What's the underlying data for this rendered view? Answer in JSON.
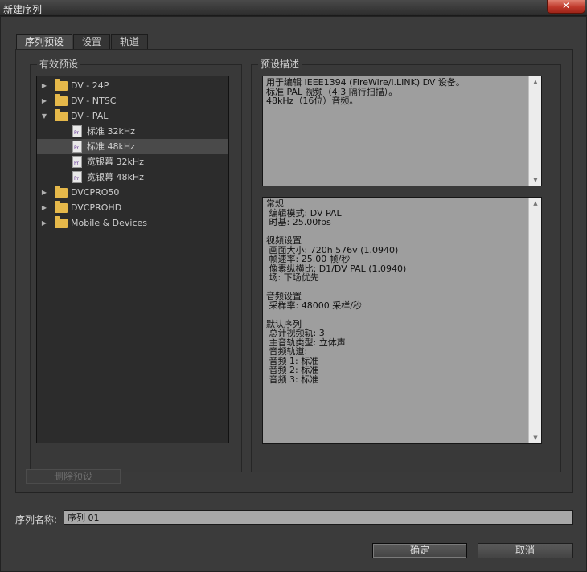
{
  "window": {
    "title": "新建序列",
    "close_glyph": "✕"
  },
  "tabs": [
    {
      "label": "序列预设",
      "active": true
    },
    {
      "label": "设置",
      "active": false
    },
    {
      "label": "轨道",
      "active": false
    }
  ],
  "presets": {
    "group_label": "有效预设",
    "tree": [
      {
        "type": "folder",
        "label": "DV - 24P",
        "expanded": false
      },
      {
        "type": "folder",
        "label": "DV - NTSC",
        "expanded": false
      },
      {
        "type": "folder",
        "label": "DV - PAL",
        "expanded": true
      },
      {
        "type": "preset",
        "label": "标准 32kHz",
        "selected": false
      },
      {
        "type": "preset",
        "label": "标准 48kHz",
        "selected": true
      },
      {
        "type": "preset",
        "label": "宽银幕 32kHz",
        "selected": false
      },
      {
        "type": "preset",
        "label": "宽银幕 48kHz",
        "selected": false
      },
      {
        "type": "folder",
        "label": "DVCPRO50",
        "expanded": false
      },
      {
        "type": "folder",
        "label": "DVCPROHD",
        "expanded": false
      },
      {
        "type": "folder",
        "label": "Mobile & Devices",
        "expanded": false
      }
    ]
  },
  "description": {
    "group_label": "预设描述",
    "summary_lines": [
      "用于编辑 IEEE1394 (FireWire/i.LINK) DV 设备。",
      "标准 PAL 视频（4:3 隔行扫描）。",
      "48kHz（16位）音频。"
    ],
    "detail_lines": [
      "常规",
      " 编辑模式: DV PAL",
      " 时基: 25.00fps",
      "",
      "视频设置",
      " 画面大小: 720h 576v (1.0940)",
      " 帧速率: 25.00 帧/秒",
      " 像素纵横比: D1/DV PAL (1.0940)",
      " 场: 下场优先",
      "",
      "音频设置",
      " 采样率: 48000 采样/秒",
      "",
      "默认序列",
      " 总计视频轨: 3",
      " 主音轨类型: 立体声",
      " 音频轨道:",
      " 音频 1: 标准",
      " 音频 2: 标准",
      " 音频 3: 标准"
    ]
  },
  "delete_button": {
    "label": "删除预设"
  },
  "sequence_name": {
    "label": "序列名称:",
    "value": "序列 01"
  },
  "buttons": {
    "ok": "确定",
    "cancel": "取消"
  }
}
